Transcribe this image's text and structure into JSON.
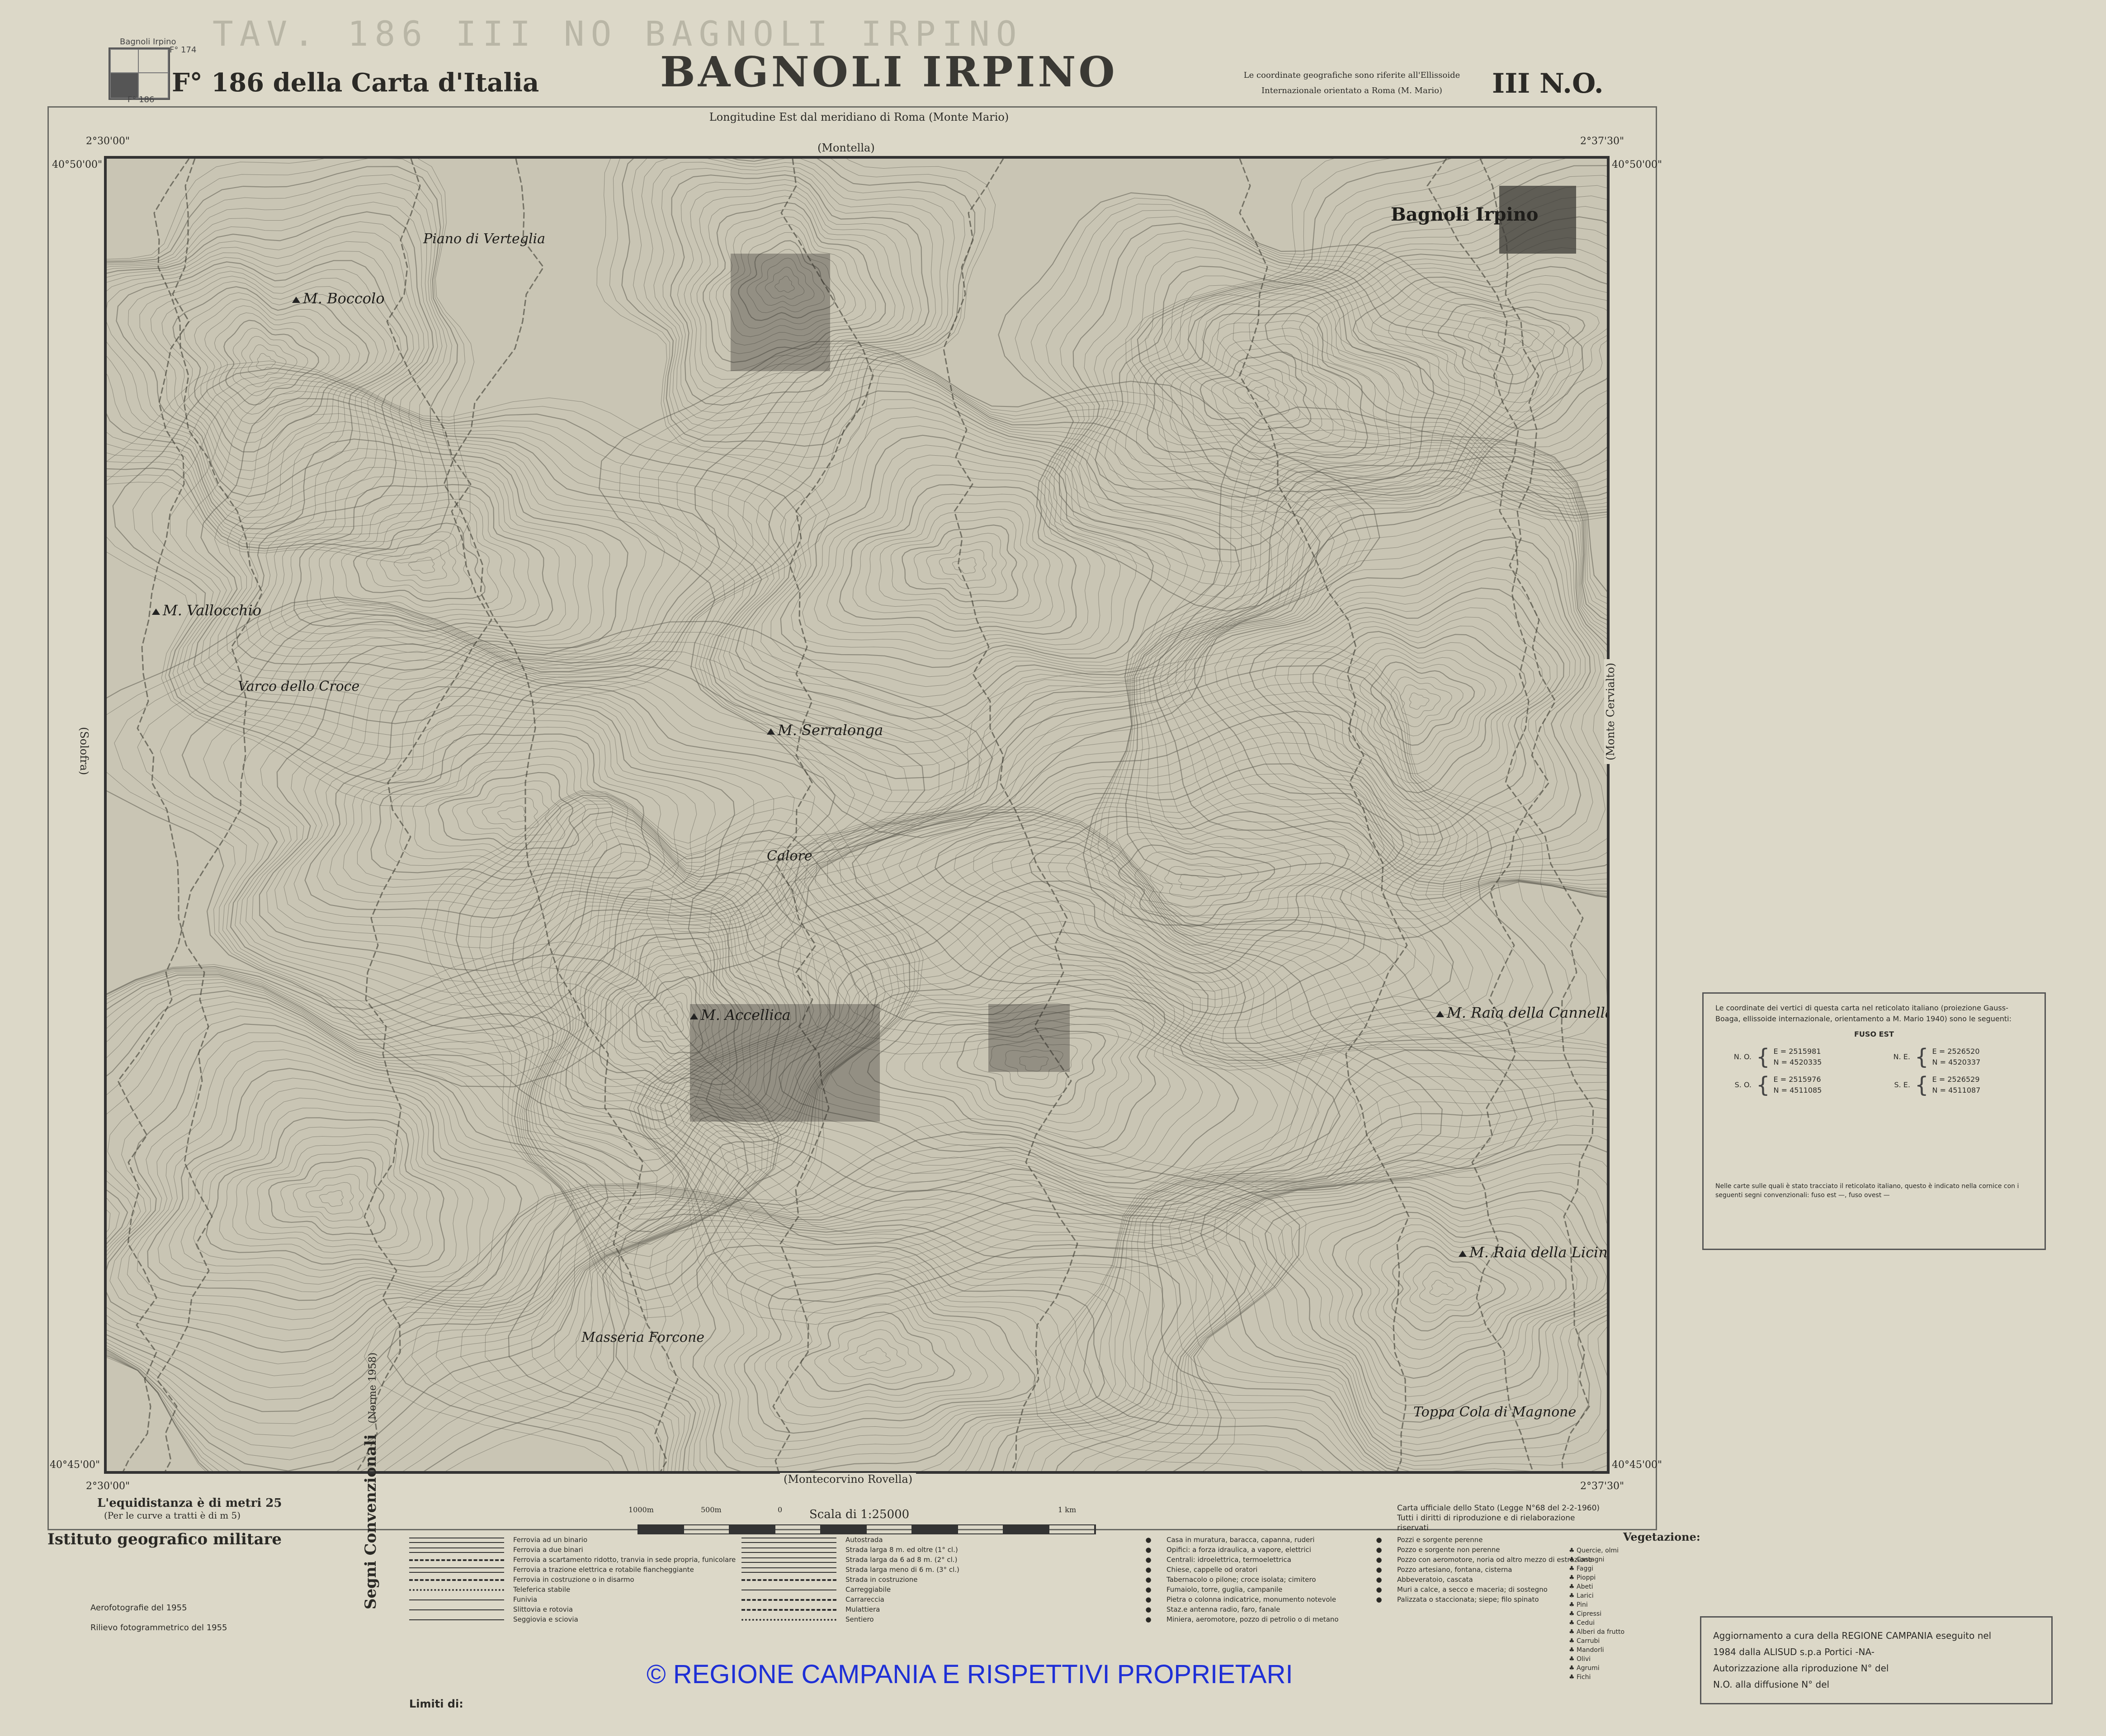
{
  "header": {
    "ghost_title": "TAV. 186  III  NO  BAGNOLI IRPINO",
    "mini_index_label": "Bagnoli Irpino",
    "mini_index_codes": [
      "F° 174",
      "F° 186"
    ],
    "foglio": "F° 186 della Carta d'Italia",
    "map_name": "BAGNOLI IRPINO",
    "ellissoide_note_1": "Le coordinate geografiche sono riferite all'Ellissoide",
    "ellissoide_note_2": "Internazionale orientato a Roma (M. Mario)",
    "quadrant": "III  N.O."
  },
  "frame": {
    "longitude_label": "Longitudine Est dal meridiano di Roma (Monte Mario)",
    "edge_north": "(Montella)",
    "edge_south": "(Montecorvino Rovella)",
    "edge_east": "(Monte Cervialto)",
    "edge_west": "(Solofra)",
    "corner_lon_w_top": "2°30'00\"",
    "corner_lon_e_top": "2°37'30\"",
    "corner_lat_n_left": "40°50'00\"",
    "corner_lat_n_right": "40°50'00\"",
    "corner_lat_s_left": "40°45'00\"",
    "corner_lat_s_right": "40°45'00\"",
    "corner_lon_w_bottom": "2°30'00\"",
    "corner_lon_e_bottom": "2°37'30\""
  },
  "map": {
    "places": [
      {
        "name": "Bagnoli Irpino",
        "kind": "town"
      },
      {
        "name": "M. Accellica",
        "kind": "peak"
      },
      {
        "name": "M. Serralonga",
        "kind": "peak"
      },
      {
        "name": "M. Raia della Cannella",
        "kind": "peak"
      },
      {
        "name": "M. Raia della Licina",
        "kind": "peak"
      },
      {
        "name": "M. Boccolo",
        "kind": "peak"
      },
      {
        "name": "M. Vallocchio",
        "kind": "peak"
      },
      {
        "name": "Piano di Verteglia",
        "kind": "locality"
      },
      {
        "name": "Varco dello Croce",
        "kind": "locality"
      },
      {
        "name": "Calore",
        "kind": "river"
      },
      {
        "name": "Masseria Forcone",
        "kind": "locality"
      },
      {
        "name": "Toppa Cola di Magnone",
        "kind": "locality"
      }
    ],
    "colors": {
      "paper": "#dcd8c8",
      "map_tint": "#c9c5b4",
      "contour": "#5f5c52",
      "ink": "#2b2a26",
      "copyright_blue": "#1e2fd6"
    }
  },
  "footer": {
    "equidistanza": "L'equidistanza è di metri 25",
    "equidistanza_sub": "(Per le curve a tratti è di m 5)",
    "istituto": "Istituto geografico militare",
    "aerofotografie": "Aerofotografie del 1955",
    "rilievo": "Rilievo fotogrammetrico del 1955",
    "scale_title": "Scala di 1:25000",
    "scale_ticks": [
      "1000m",
      "500m",
      "0",
      "1 km"
    ],
    "ufficiale_1": "Carta ufficiale dello Stato (Legge N°68 del 2-2-1960)",
    "ufficiale_2": "Tutti i diritti di riproduzione e di rielaborazione riservati",
    "segni_title": "Segni Convenzionali",
    "segni_sub": "(Norme 1958)",
    "limiti": "Limiti di:",
    "vegetazione_title": "Vegetazione:"
  },
  "legend": {
    "rail": [
      {
        "style": "double",
        "label": "Ferrovia ad un binario"
      },
      {
        "style": "double",
        "label": "Ferrovia a due binari"
      },
      {
        "style": "dash",
        "label": "Ferrovia a scartamento ridotto, tranvia in sede propria, funicolare"
      },
      {
        "style": "double",
        "label": "Ferrovia a trazione elettrica e rotabile fiancheggiante"
      },
      {
        "style": "dash",
        "label": "Ferrovia in costruzione o in disarmo"
      },
      {
        "style": "dot",
        "label": "Teleferica stabile"
      },
      {
        "style": "thin",
        "label": "Funivia"
      },
      {
        "style": "thin",
        "label": "Slittovia e rotovia"
      },
      {
        "style": "thin",
        "label": "Seggiovia e sciovia"
      }
    ],
    "roads": [
      {
        "style": "double",
        "label": "Autostrada"
      },
      {
        "style": "double",
        "label": "Strada larga 8 m. ed oltre (1° cl.)"
      },
      {
        "style": "double",
        "label": "Strada larga da 6 ad 8 m. (2° cl.)"
      },
      {
        "style": "double",
        "label": "Strada larga meno di 6 m. (3° cl.)"
      },
      {
        "style": "dash",
        "label": "Strada in costruzione"
      },
      {
        "style": "thin",
        "label": "Carreggiabile"
      },
      {
        "style": "dash",
        "label": "Carrareccia"
      },
      {
        "style": "dash",
        "label": "Mulattiera"
      },
      {
        "style": "dot",
        "label": "Sentiero"
      }
    ],
    "buildings": [
      {
        "icon": "house-icon",
        "label": "Casa in muratura, baracca, capanna, ruderi"
      },
      {
        "icon": "factory-icon",
        "label": "Opifici: a forza idraulica, a vapore, elettrici"
      },
      {
        "icon": "power-icon",
        "label": "Centrali: idroelettrica, termoelettrica"
      },
      {
        "icon": "church-icon",
        "label": "Chiese, cappelle od oratori"
      },
      {
        "icon": "cross-icon",
        "label": "Tabernacolo o pilone; croce isolata; cimitero"
      },
      {
        "icon": "chimney-icon",
        "label": "Fumaiolo, torre, guglia, campanile"
      },
      {
        "icon": "stone-icon",
        "label": "Pietra o colonna indicatrice, monumento notevole"
      },
      {
        "icon": "antenna-icon",
        "label": "Staz.e antenna radio, faro, fanale"
      },
      {
        "icon": "mine-icon",
        "label": "Miniera, aeromotore, pozzo di petrolio o di metano"
      }
    ],
    "water": [
      {
        "icon": "well-icon",
        "label": "Pozzi e sorgente perenne"
      },
      {
        "icon": "spring-icon",
        "label": "Pozzo e sorgente non perenne"
      },
      {
        "icon": "pump-icon",
        "label": "Pozzo con aeromotore, noria od altro mezzo di estrazione"
      },
      {
        "icon": "fountain-icon",
        "label": "Pozzo artesiano, fontana, cisterna"
      },
      {
        "icon": "trough-icon",
        "label": "Abbeveratoio, cascata"
      },
      {
        "icon": "wall-icon",
        "label": "Muri a calce, a secco e maceria; di sostegno"
      },
      {
        "icon": "fence-icon",
        "label": "Palizzata o staccionata; siepe; filo spinato"
      }
    ],
    "vegetazione": [
      "Quercie, olmi",
      "Castagni",
      "Faggi",
      "Pioppi",
      "Abeti",
      "Larici",
      "Pini",
      "Cipressi",
      "Cedui",
      "Alberi da frutto",
      "Carrubi",
      "Mandorli",
      "Olivi",
      "Agrumi",
      "Fichi"
    ]
  },
  "coord_panel": {
    "intro": "Le coordinate dei vertici di questa carta nel reticolato italiano (proiezione Gauss-Boaga, ellissoide internazionale, orientamento a M. Mario 1940) sono le seguenti:",
    "fuso": "FUSO EST",
    "vertices": [
      {
        "corner": "N. O.",
        "E": "E = 2515981",
        "N": "N = 4520335"
      },
      {
        "corner": "N. E.",
        "E": "E = 2526520",
        "N": "N = 4520337"
      },
      {
        "corner": "S. O.",
        "E": "E = 2515976",
        "N": "N = 4511085"
      },
      {
        "corner": "S. E.",
        "E": "E = 2526529",
        "N": "N = 4511087"
      }
    ],
    "note": "Nelle carte sulle quali è stato tracciato il reticolato italiano, questo è indicato nella cornice con i seguenti segni convenzionali: fuso est —, fuso ovest —"
  },
  "update_panel": {
    "line1": "Aggiornamento a cura della REGIONE CAMPANIA eseguito nel",
    "line2": "1984 dalla ALISUD s.p.a Portici -NA-",
    "line3": "Autorizzazione alla riproduzione N°          del",
    "line4": "N.O. alla diffusione N°          del"
  },
  "copyright": "© REGIONE CAMPANIA E RISPETTIVI PROPRIETARI"
}
